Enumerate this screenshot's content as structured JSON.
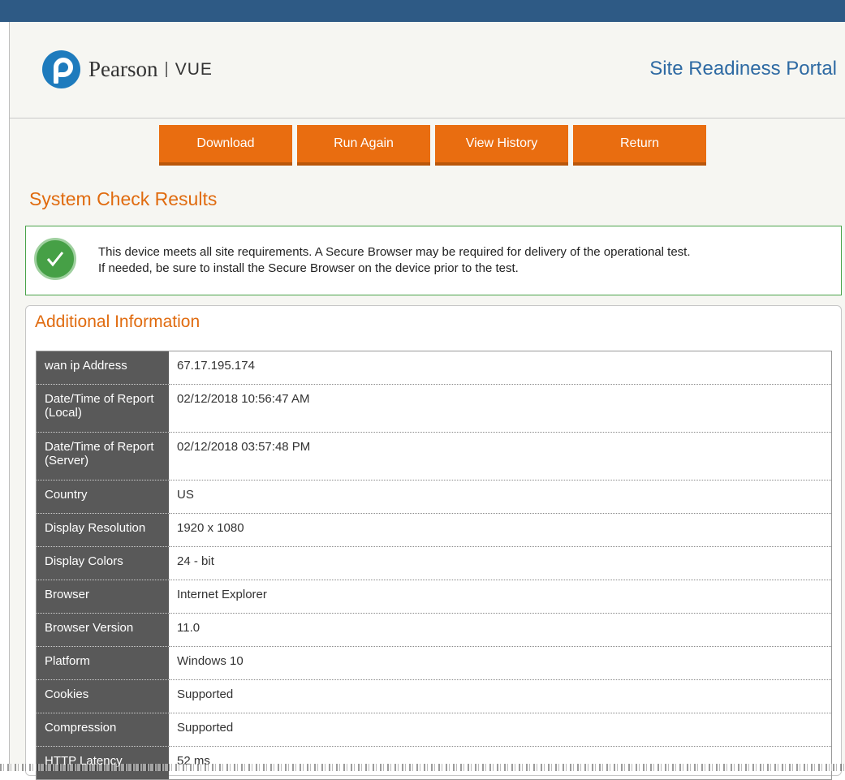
{
  "header": {
    "brand": "Pearson",
    "separator": "|",
    "sub_brand": "VUE",
    "portal_title": "Site Readiness Portal"
  },
  "buttons": {
    "download": "Download",
    "run_again": "Run Again",
    "view_history": "View History",
    "return": "Return"
  },
  "results": {
    "title": "System Check Results",
    "message_line1": "This device meets all site requirements. A Secure Browser may be required for delivery of the operational test.",
    "message_line2": "If needed, be sure to install the Secure Browser on the device prior to the test."
  },
  "additional_info": {
    "title": "Additional Information",
    "rows": [
      {
        "label": "wan ip Address",
        "value": "67.17.195.174"
      },
      {
        "label": "Date/Time of Report (Local)",
        "value": "02/12/2018 10:56:47 AM"
      },
      {
        "label": "Date/Time of Report (Server)",
        "value": "02/12/2018 03:57:48 PM"
      },
      {
        "label": "Country",
        "value": "US"
      },
      {
        "label": "Display Resolution",
        "value": "1920 x 1080"
      },
      {
        "label": "Display Colors",
        "value": "24 - bit"
      },
      {
        "label": "Browser",
        "value": "Internet Explorer"
      },
      {
        "label": "Browser Version",
        "value": "11.0"
      },
      {
        "label": "Platform",
        "value": "Windows 10"
      },
      {
        "label": "Cookies",
        "value": "Supported"
      },
      {
        "label": "Compression",
        "value": "Supported"
      },
      {
        "label": "HTTP Latency",
        "value": "52 ms"
      }
    ]
  },
  "colors": {
    "top_bar": "#2e5a85",
    "accent_orange": "#e96d10",
    "title_blue": "#2e6aa3",
    "success_green": "#46a046",
    "label_bg": "#595959"
  }
}
